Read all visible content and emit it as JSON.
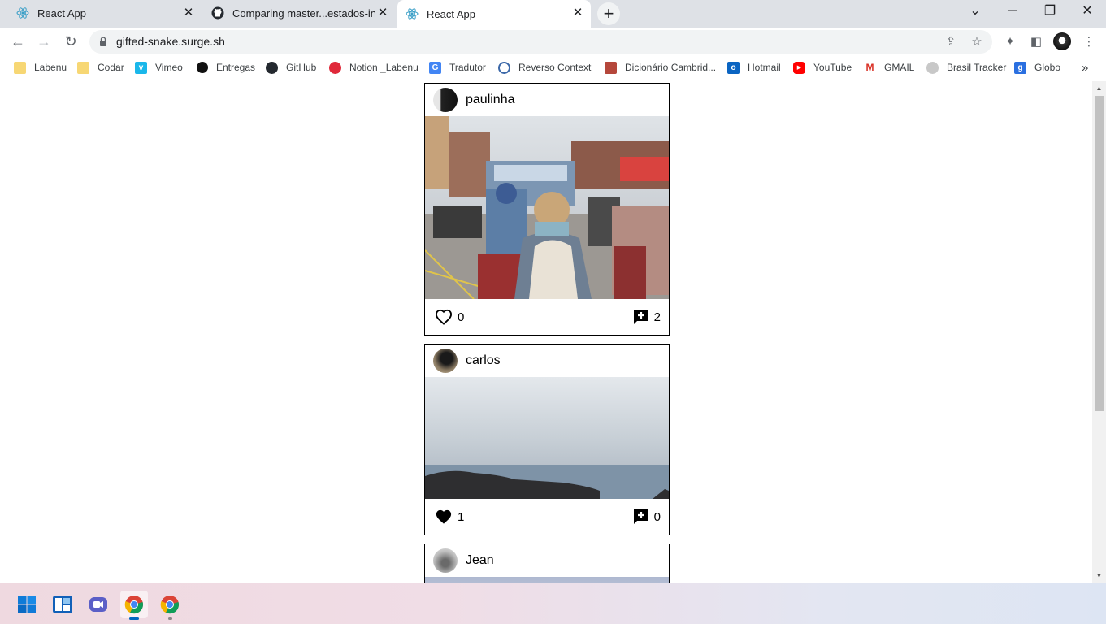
{
  "browser": {
    "tabs": [
      {
        "title": "React App",
        "icon": "react-icon",
        "active": false
      },
      {
        "title": "Comparing master...estados-insta",
        "icon": "github-icon",
        "active": false
      },
      {
        "title": "React App",
        "icon": "react-icon",
        "active": true
      }
    ],
    "new_tab_label": "+",
    "url": "gifted-snake.surge.sh",
    "bookmarks": [
      {
        "label": "Labenu",
        "icon": "folder-icon"
      },
      {
        "label": "Codar",
        "icon": "folder-icon"
      },
      {
        "label": "Vimeo",
        "icon": "vimeo-icon"
      },
      {
        "label": "Entregas",
        "icon": "dot-icon"
      },
      {
        "label": "GitHub",
        "icon": "github-icon"
      },
      {
        "label": "Notion _Labenu",
        "icon": "apple-icon"
      },
      {
        "label": "Tradutor",
        "icon": "translate-icon"
      },
      {
        "label": "Reverso Context",
        "icon": "reverso-icon"
      },
      {
        "label": "Dicionário Cambrid...",
        "icon": "cambridge-icon"
      },
      {
        "label": "Hotmail",
        "icon": "outlook-icon"
      },
      {
        "label": "YouTube",
        "icon": "youtube-icon"
      },
      {
        "label": "GMAIL",
        "icon": "gmail-icon"
      },
      {
        "label": "Brasil Tracker",
        "icon": "lock-icon"
      },
      {
        "label": "Globo",
        "icon": "globo-icon"
      }
    ],
    "more_bookmarks": "»"
  },
  "posts": [
    {
      "user": "paulinha",
      "likes": "0",
      "liked": false,
      "comments": "2"
    },
    {
      "user": "carlos",
      "likes": "1",
      "liked": true,
      "comments": "0"
    },
    {
      "user": "Jean",
      "likes": "",
      "liked": false,
      "comments": ""
    }
  ],
  "taskbar": {
    "apps": [
      "windows-start-icon",
      "widgets-icon",
      "teams-chat-icon",
      "chrome-icon",
      "chrome-icon"
    ]
  }
}
